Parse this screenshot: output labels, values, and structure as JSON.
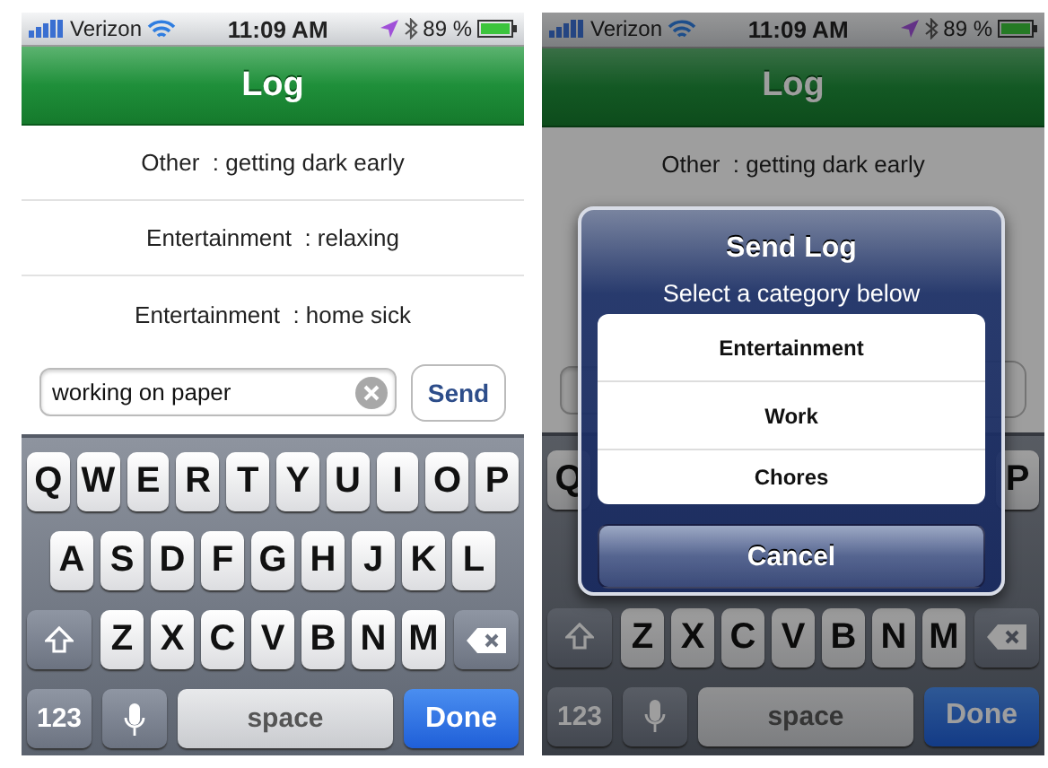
{
  "screens": [
    {
      "status_bar": {
        "carrier": "Verizon",
        "time": "11:09 AM",
        "battery": "89 %"
      },
      "title": "Log",
      "dimmed": false,
      "entries": [
        {
          "text": "Other  : getting dark early"
        },
        {
          "text": "Entertainment  : relaxing"
        },
        {
          "text": "Entertainment  : home sick"
        }
      ],
      "composer": {
        "value": "working on paper",
        "button": "Send"
      },
      "keyboard": {
        "row_1": [
          "Q",
          "W",
          "E",
          "R",
          "T",
          "Y",
          "U",
          "I",
          "O",
          "P"
        ],
        "row_2": [
          "A",
          "S",
          "D",
          "F",
          "G",
          "H",
          "J",
          "K",
          "L"
        ],
        "row_3": [
          "Z",
          "X",
          "C",
          "V",
          "B",
          "N",
          "M"
        ],
        "mode_key": "123",
        "space_key": "space",
        "return_key": "Done"
      }
    },
    {
      "status_bar": {
        "carrier": "Verizon",
        "time": "11:09 AM",
        "battery": "89 %"
      },
      "title": "Log",
      "dimmed": true,
      "entries": [
        {
          "text": "Other  : getting dark early"
        }
      ],
      "keyboard": {
        "row_1": [
          "Q",
          "P"
        ],
        "row_3": [
          "Z",
          "X",
          "C",
          "V",
          "B",
          "N",
          "M"
        ],
        "mode_key": "123",
        "space_key": "space",
        "return_key": "Done"
      },
      "alert": {
        "title": "Send Log",
        "message": "Select a category below",
        "options": [
          "Entertainment",
          "Work",
          "Chores"
        ],
        "cancel": "Cancel"
      }
    }
  ]
}
